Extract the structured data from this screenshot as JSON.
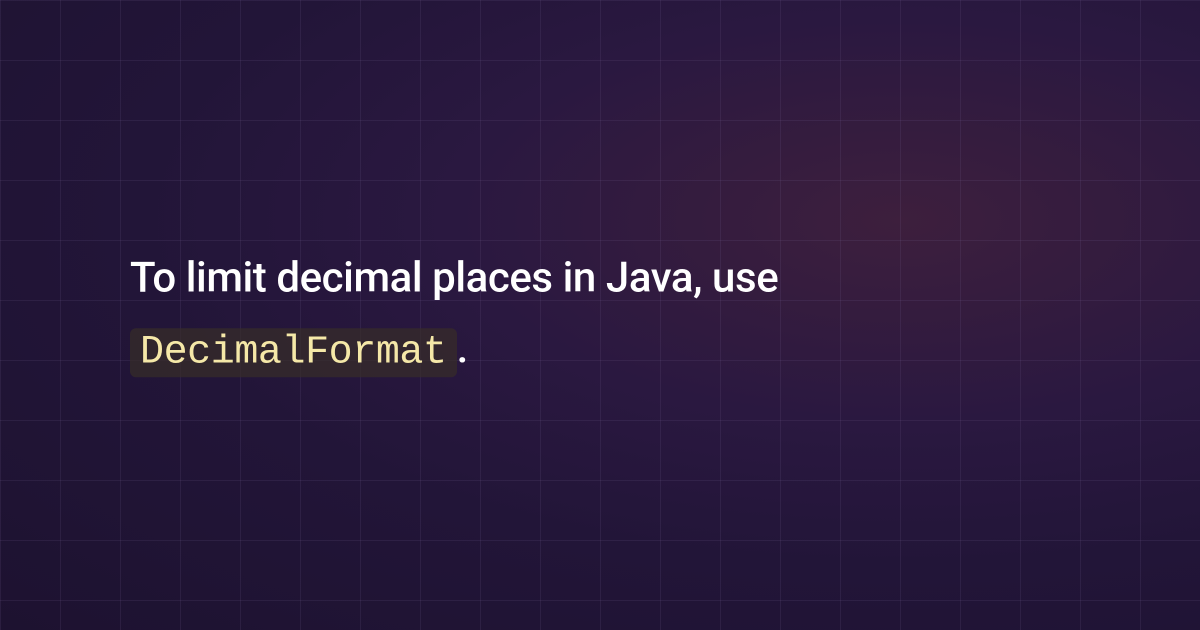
{
  "heading": {
    "prefix": "To limit decimal places in Java, use ",
    "code": "DecimalFormat",
    "suffix": "."
  }
}
